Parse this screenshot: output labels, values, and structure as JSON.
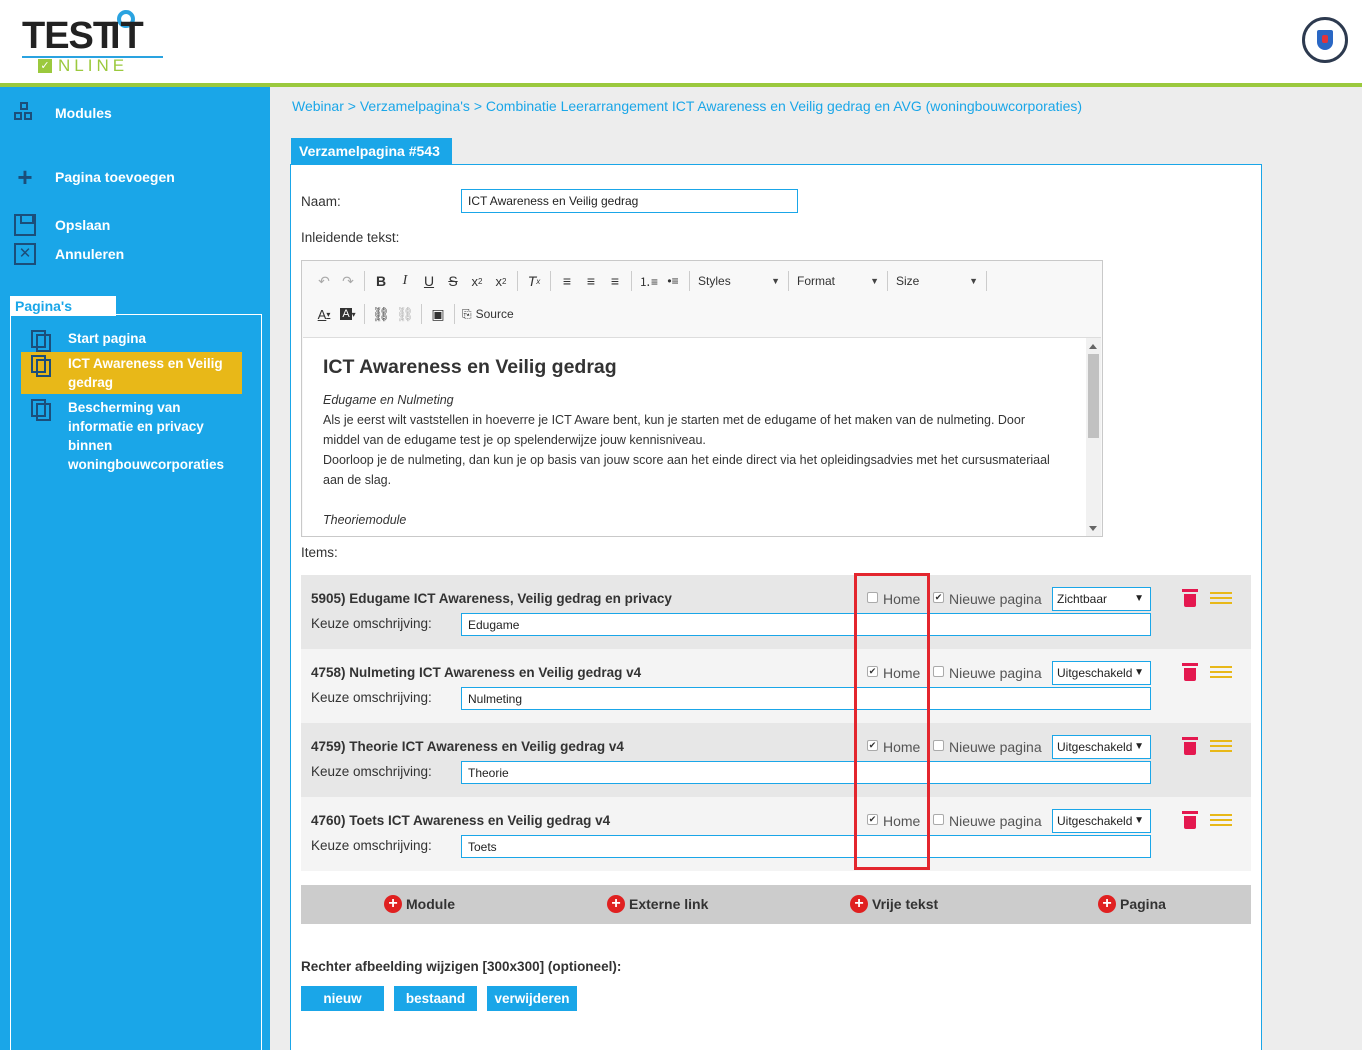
{
  "header": {
    "logo_test": "TEST",
    "logo_it": "IT",
    "logo_online": "NLINE",
    "avatar_icon": "shield-icon"
  },
  "sidebar": {
    "modules": "Modules",
    "add_page": "Pagina toevoegen",
    "save": "Opslaan",
    "cancel": "Annuleren",
    "pages_tab": "Pagina's",
    "pages": [
      {
        "label": "Start pagina",
        "active": false
      },
      {
        "label": "ICT Awareness en Veilig gedrag",
        "active": true
      },
      {
        "label": "Bescherming van informatie en privacy binnen woningbouwcorporaties",
        "active": false
      }
    ]
  },
  "breadcrumb": {
    "b1": "Webinar",
    "sep": ">",
    "b2": "Verzamelpagina's",
    "b3": "Combinatie Leerarrangement ICT Awareness en Veilig gedrag en AVG (woningbouwcorporaties)"
  },
  "card": {
    "tab": "Verzamelpagina #543",
    "naam_label": "Naam:",
    "naam_value": "ICT Awareness en Veilig gedrag",
    "intro_label": "Inleidende tekst:",
    "items_label": "Items:"
  },
  "editor": {
    "styles": "Styles",
    "format": "Format",
    "size": "Size",
    "source": "Source",
    "heading": "ICT Awareness en Veilig gedrag",
    "p1_italic": "Edugame en Nulmeting",
    "p1": "Als je eerst wilt vaststellen in hoeverre je ICT Aware bent, kun je starten met de edugame of het maken van de nulmeting. Door middel van de edugame test je op spelenderwijze jouw kennisniveau.",
    "p2": "Doorloop je de nulmeting, dan kun je op basis van jouw score aan het einde direct via het opleidingsadvies met het cursusmateriaal aan de slag.",
    "p3_italic": "Theoriemodule"
  },
  "items": [
    {
      "title": "5905) Edugame ICT Awareness, Veilig gedrag en privacy",
      "keuze_label": "Keuze omschrijving:",
      "keuze": "Edugame",
      "home_label": "Home",
      "home": false,
      "new_label": "Nieuwe pagina",
      "new_page": true,
      "visibility": "Zichtbaar"
    },
    {
      "title": "4758) Nulmeting ICT Awareness en Veilig gedrag v4",
      "keuze_label": "Keuze omschrijving:",
      "keuze": "Nulmeting",
      "home_label": "Home",
      "home": true,
      "new_label": "Nieuwe pagina",
      "new_page": false,
      "visibility": "Uitgeschakeld"
    },
    {
      "title": "4759) Theorie ICT Awareness en Veilig gedrag v4",
      "keuze_label": "Keuze omschrijving:",
      "keuze": "Theorie",
      "home_label": "Home",
      "home": true,
      "new_label": "Nieuwe pagina",
      "new_page": false,
      "visibility": "Uitgeschakeld"
    },
    {
      "title": "4760) Toets ICT Awareness en Veilig gedrag v4",
      "keuze_label": "Keuze omschrijving:",
      "keuze": "Toets",
      "home_label": "Home",
      "home": true,
      "new_label": "Nieuwe pagina",
      "new_page": false,
      "visibility": "Uitgeschakeld"
    }
  ],
  "addbar": {
    "module": "Module",
    "external": "Externe link",
    "free_text": "Vrije tekst",
    "page": "Pagina"
  },
  "right_image": {
    "label": "Rechter afbeelding wijzigen [300x300] (optioneel):",
    "new": "nieuw",
    "existing": "bestaand",
    "remove": "verwijderen"
  },
  "colors": {
    "brand_blue": "#1aa6e8",
    "brand_green": "#9bc93d",
    "active_yellow": "#e8b818",
    "highlight_red": "#e3262e",
    "delete_pink": "#e4184f"
  }
}
